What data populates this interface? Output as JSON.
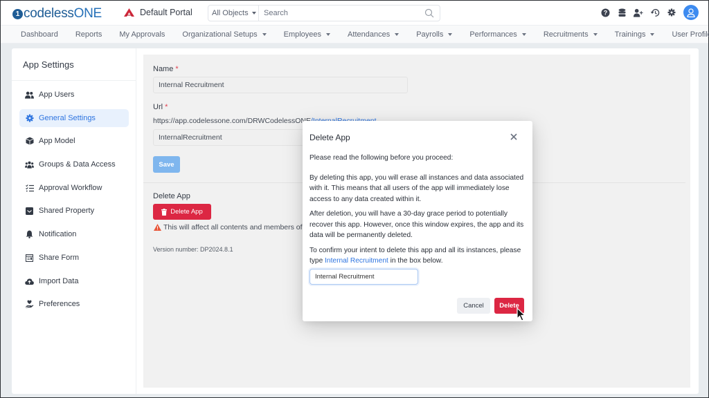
{
  "brand": {
    "logo_mark": "1",
    "logo_text_prefix": "codeless",
    "logo_text_suffix": "ONE",
    "portal_name": "Default Portal"
  },
  "search": {
    "scope": "All Objects",
    "placeholder": "Search",
    "value": ""
  },
  "top_icons": [
    "help-icon",
    "database-icon",
    "add-user-icon",
    "history-icon",
    "gear-icon",
    "avatar-user-icon"
  ],
  "nav": {
    "items": [
      {
        "label": "Dashboard",
        "dropdown": false
      },
      {
        "label": "Reports",
        "dropdown": false
      },
      {
        "label": "My Approvals",
        "dropdown": false
      },
      {
        "label": "Organizational Setups",
        "dropdown": true
      },
      {
        "label": "Employees",
        "dropdown": true
      },
      {
        "label": "Attendances",
        "dropdown": true
      },
      {
        "label": "Payrolls",
        "dropdown": true
      },
      {
        "label": "Performances",
        "dropdown": true
      },
      {
        "label": "Recruitments",
        "dropdown": true
      },
      {
        "label": "Trainings",
        "dropdown": true
      },
      {
        "label": "User Profiles",
        "dropdown": true
      }
    ]
  },
  "sidebar": {
    "title": "App Settings",
    "items": [
      {
        "label": "App Users",
        "icon": "users-icon"
      },
      {
        "label": "General Settings",
        "icon": "gear-icon",
        "active": true
      },
      {
        "label": "App Model",
        "icon": "cube-icon"
      },
      {
        "label": "Groups & Data Access",
        "icon": "groups-icon"
      },
      {
        "label": "Approval Workflow",
        "icon": "checklist-icon"
      },
      {
        "label": "Shared Property",
        "icon": "inbox-icon"
      },
      {
        "label": "Notification",
        "icon": "bell-icon"
      },
      {
        "label": "Share Form",
        "icon": "form-icon"
      },
      {
        "label": "Import Data",
        "icon": "cloud-upload-icon"
      },
      {
        "label": "Preferences",
        "icon": "hand-heart-icon"
      }
    ]
  },
  "form": {
    "name_label": "Name",
    "name_value": "Internal Recruitment",
    "url_label": "Url",
    "url_base": "https://app.codelessone.com/DRWCodelessONE",
    "url_slug_display": "/InternalRecruitment",
    "url_value": "InternalRecruitment",
    "required_mark": "*",
    "save_label": "Save",
    "delete_section_label": "Delete App",
    "delete_button_label": "Delete App",
    "warning_text": "This will affect all contents and members of this app.",
    "version_text": "Version number: DP2024.8.1"
  },
  "modal": {
    "title": "Delete App",
    "intro": "Please read the following before you proceed:",
    "para1": "By deleting this app, you will erase all instances and data associated with it. This means that all users of the app will immediately lose access to any data created within it.",
    "para2": "After deletion, you will have a 30-day grace period to potentially recover this app. However, once this window expires, the app and its data will be permanently deleted.",
    "para3_prefix": "To confirm your intent to delete this app and all its instances, please type ",
    "para3_highlight": "Internal Recruitment",
    "para3_suffix": " in the box below.",
    "confirm_value": "Internal Recruitment",
    "cancel_label": "Cancel",
    "delete_label": "Delete"
  },
  "colors": {
    "brand": "#1f5d96",
    "accent": "#2d74e0",
    "danger": "#dc2743",
    "save_disabled": "#7fb6ee"
  }
}
